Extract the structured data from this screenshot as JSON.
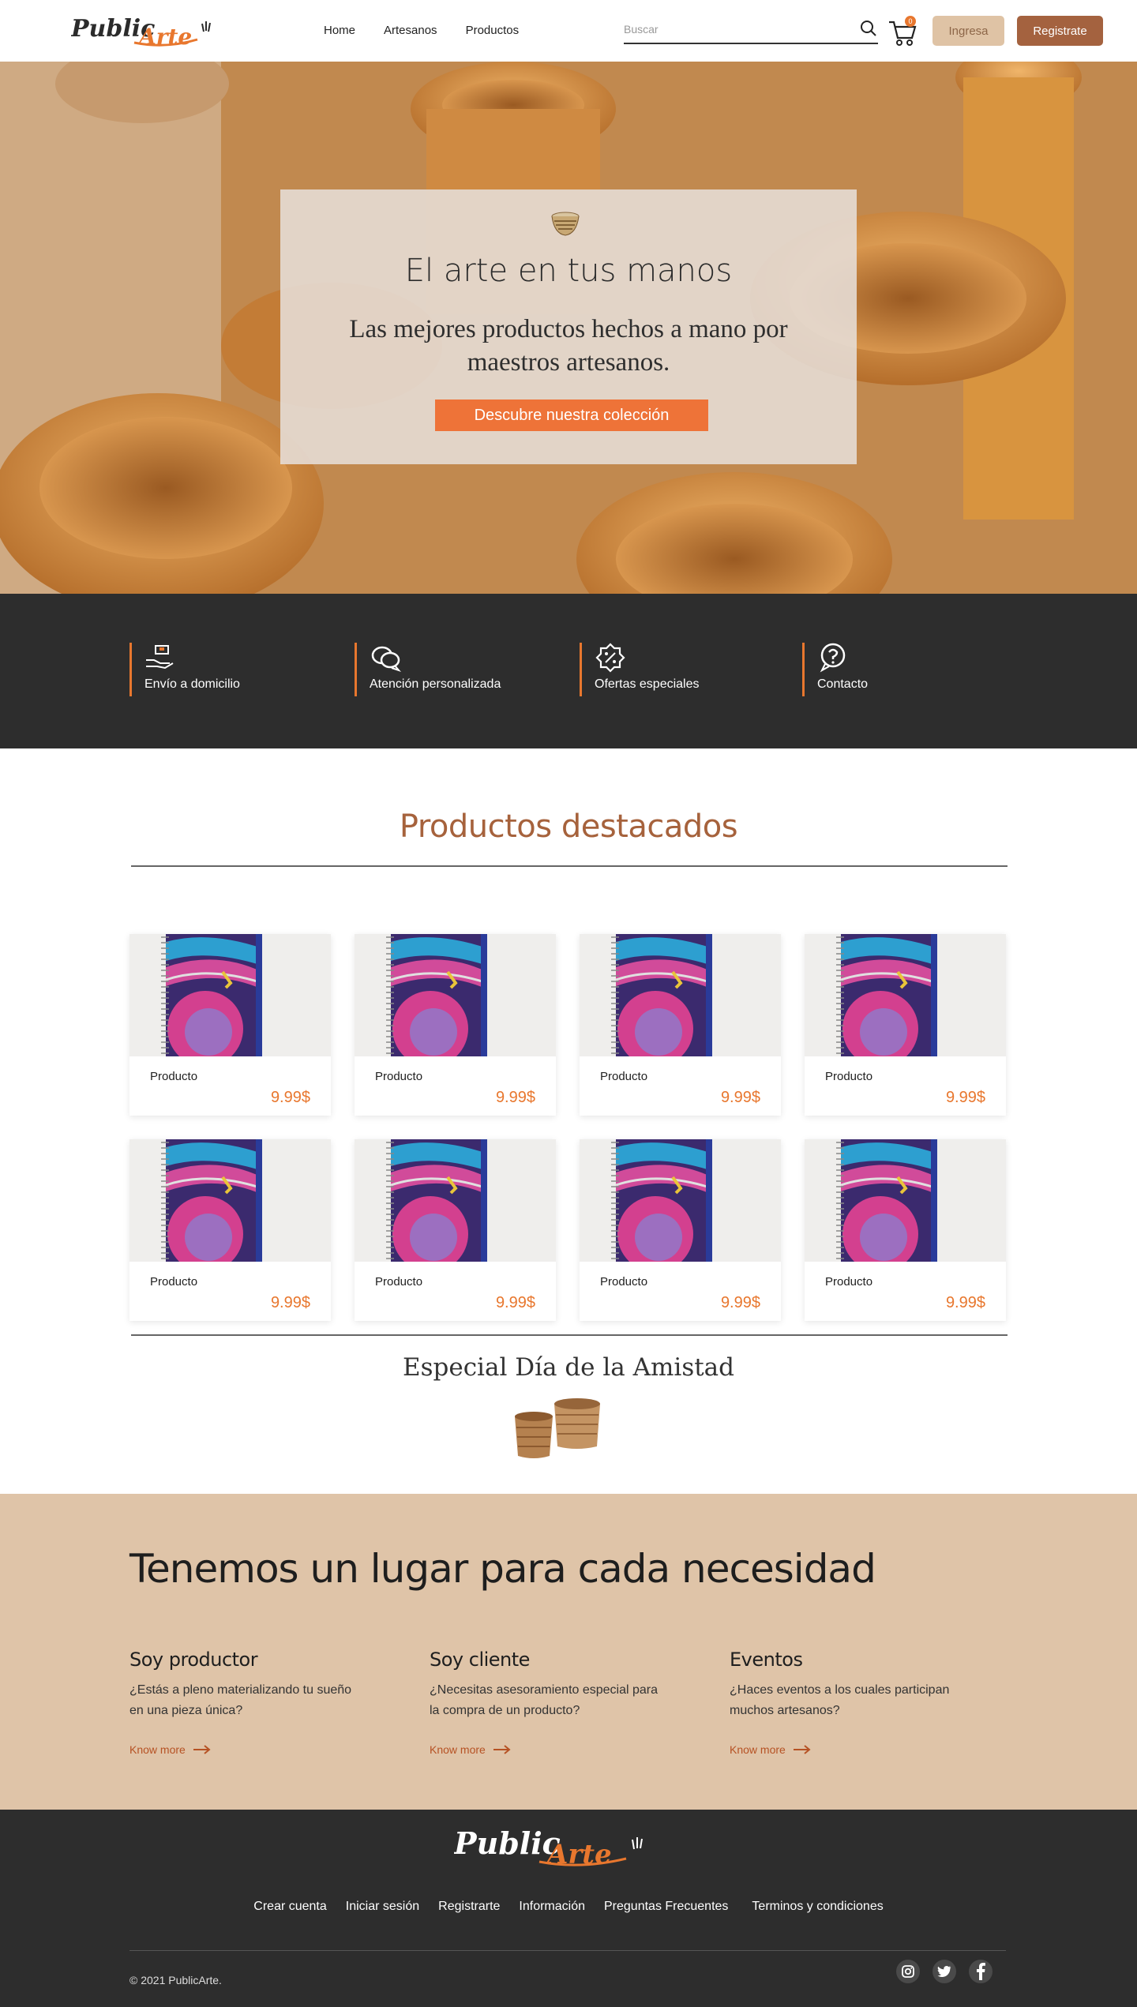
{
  "header": {
    "logo_text": "PublicArte",
    "nav": [
      "Home",
      "Artesanos",
      "Productos"
    ],
    "search_placeholder": "Buscar",
    "cart_count": "0",
    "login_label": "Ingresa",
    "register_label": "Registrate"
  },
  "hero": {
    "title": "El arte en tus manos",
    "subtitle": "Las mejores productos hechos a mano por maestros artesanos.",
    "cta_label": "Descubre nuestra colección"
  },
  "features": [
    {
      "label": "Envío a domicilio",
      "icon": "delivery-hand-icon"
    },
    {
      "label": "Atención personalizada",
      "icon": "chat-bubbles-icon"
    },
    {
      "label": "Ofertas especiales",
      "icon": "discount-badge-icon"
    },
    {
      "label": "Contacto",
      "icon": "help-bubble-icon"
    }
  ],
  "products": {
    "title": "Productos destacados",
    "items": [
      {
        "name": "Producto",
        "price": "9.99$"
      },
      {
        "name": "Producto",
        "price": "9.99$"
      },
      {
        "name": "Producto",
        "price": "9.99$"
      },
      {
        "name": "Producto",
        "price": "9.99$"
      },
      {
        "name": "Producto",
        "price": "9.99$"
      },
      {
        "name": "Producto",
        "price": "9.99$"
      },
      {
        "name": "Producto",
        "price": "9.99$"
      },
      {
        "name": "Producto",
        "price": "9.99$"
      }
    ]
  },
  "special": {
    "title": "Especial Día de la Amistad"
  },
  "needs": {
    "title": "Tenemos un lugar para cada necesidad",
    "columns": [
      {
        "title": "Soy productor",
        "text": "¿Estás a pleno materializando tu sueño en una pieza única?",
        "link": "Know more"
      },
      {
        "title": "Soy cliente",
        "text": "¿Necesitas asesoramiento especial para la compra de un producto?",
        "link": "Know more"
      },
      {
        "title": "Eventos",
        "text": "¿Haces eventos a los cuales participan muchos artesanos?",
        "link": "Know more"
      }
    ]
  },
  "footer": {
    "links": [
      "Crear cuenta",
      "Iniciar sesión",
      "Registrarte",
      "Información",
      "Preguntas Frecuentes",
      "Terminos y condiciones"
    ],
    "copyright": "© 2021 PublicArte.",
    "social": [
      "instagram-icon",
      "twitter-icon",
      "facebook-icon"
    ]
  },
  "colors": {
    "accent": "#e8772e",
    "brown": "#a4623f",
    "beige": "#dfc4a8",
    "dark": "#2d2d2d"
  }
}
